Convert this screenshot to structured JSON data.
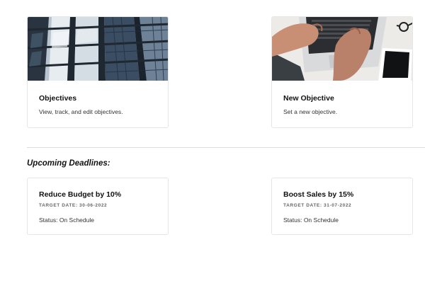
{
  "cards": [
    {
      "title": "Objectives",
      "description": "View, track, and edit objectives.",
      "image": "building-facade-photo"
    },
    {
      "title": "New Objective",
      "description": "Set a new objective.",
      "image": "laptop-typing-photo"
    }
  ],
  "deadlines": {
    "heading": "Upcoming Deadlines:",
    "items": [
      {
        "title": "Reduce Budget by 10%",
        "target": "TARGET DATE: 30-06-2022",
        "status": "Status: On Schedule"
      },
      {
        "title": "Boost Sales by 15%",
        "target": "TARGET DATE: 31-07-2022",
        "status": "Status: On Schedule"
      }
    ]
  }
}
